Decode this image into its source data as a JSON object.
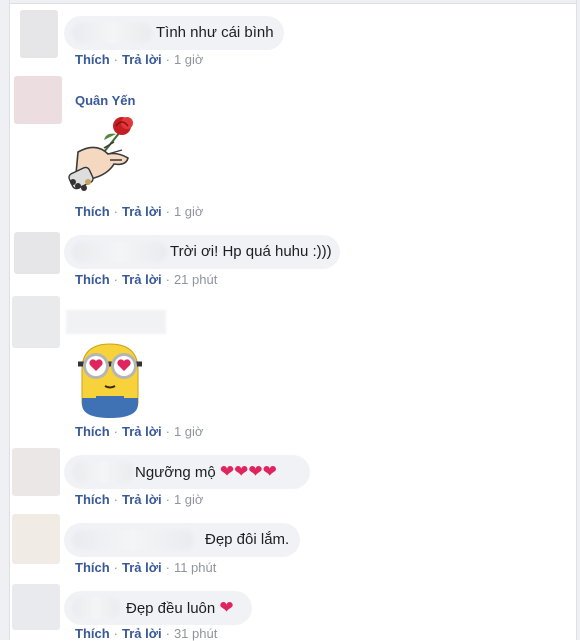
{
  "comments": [
    {
      "text": "Tình như cái bình",
      "like": "Thích",
      "reply": "Trả lời",
      "time": "1 giờ"
    },
    {
      "author": "Quân Yến",
      "like": "Thích",
      "reply": "Trả lời",
      "time": "1 giờ"
    },
    {
      "text": "Trời ơi! Hp quá huhu :)))",
      "like": "Thích",
      "reply": "Trả lời",
      "time": "21 phút"
    },
    {
      "like": "Thích",
      "reply": "Trả lời",
      "time": "1 giờ"
    },
    {
      "text": "Ngưỡng mộ",
      "hearts": "❤❤❤❤",
      "like": "Thích",
      "reply": "Trả lời",
      "time": "1 giờ"
    },
    {
      "text": "Đẹp đôi lắm.",
      "like": "Thích",
      "reply": "Trả lời",
      "time": "11 phút"
    },
    {
      "text": "Đẹp đều luôn",
      "hearts": "❤",
      "like": "Thích",
      "reply": "Trả lời",
      "time": "31 phút"
    }
  ],
  "separator": "·",
  "colors": {
    "link": "#385898",
    "meta": "#90949c",
    "bubble": "#f0f2f5",
    "heart": "#e0245e"
  },
  "icons": [
    "rose-hand-sticker",
    "minion-heart-eyes-sticker",
    "heart-icon"
  ]
}
